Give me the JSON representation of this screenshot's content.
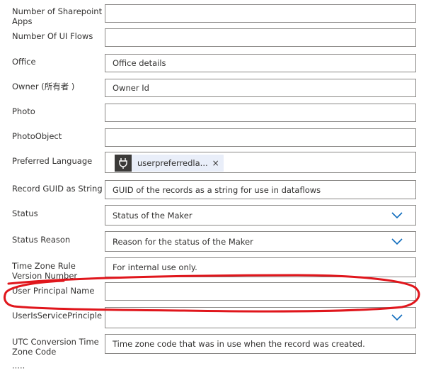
{
  "fields": [
    {
      "id": "sharepoint",
      "label": "Number of Sharepoint Apps",
      "value": ""
    },
    {
      "id": "uiflows",
      "label": "Number Of UI Flows",
      "value": ""
    },
    {
      "id": "office",
      "label": "Office",
      "value": "Office details"
    },
    {
      "id": "owner",
      "label": "Owner (所有者 )",
      "value": "Owner Id"
    },
    {
      "id": "photo",
      "label": "Photo",
      "value": ""
    },
    {
      "id": "photoobject",
      "label": "PhotoObject",
      "value": ""
    },
    {
      "id": "language",
      "label": "Preferred Language",
      "tag": "userpreferredla...",
      "tag_icon": "plug-icon",
      "remove": "×"
    },
    {
      "id": "guid",
      "label": "Record GUID as String",
      "value": "GUID of the records as a string for use in dataflows"
    },
    {
      "id": "status",
      "label": "Status",
      "value": "Status of the Maker",
      "dropdown": true
    },
    {
      "id": "statusreason",
      "label": "Status Reason",
      "value": "Reason for the status of the Maker",
      "dropdown": true
    },
    {
      "id": "tzrule",
      "label": "Time Zone Rule Version Number",
      "value": "For internal use only."
    },
    {
      "id": "upn",
      "label": "User Principal Name",
      "value": ""
    },
    {
      "id": "isservice",
      "label": "UserIsServicePrinciple",
      "value": "",
      "dropdown": true
    },
    {
      "id": "utc",
      "label": "UTC Conversion Time Zone Code",
      "value": "Time zone code that was in use when the record was created."
    }
  ],
  "colors": {
    "annotation": "#e0161c",
    "border": "#8a8886",
    "chevron": "#0f6cbd"
  }
}
